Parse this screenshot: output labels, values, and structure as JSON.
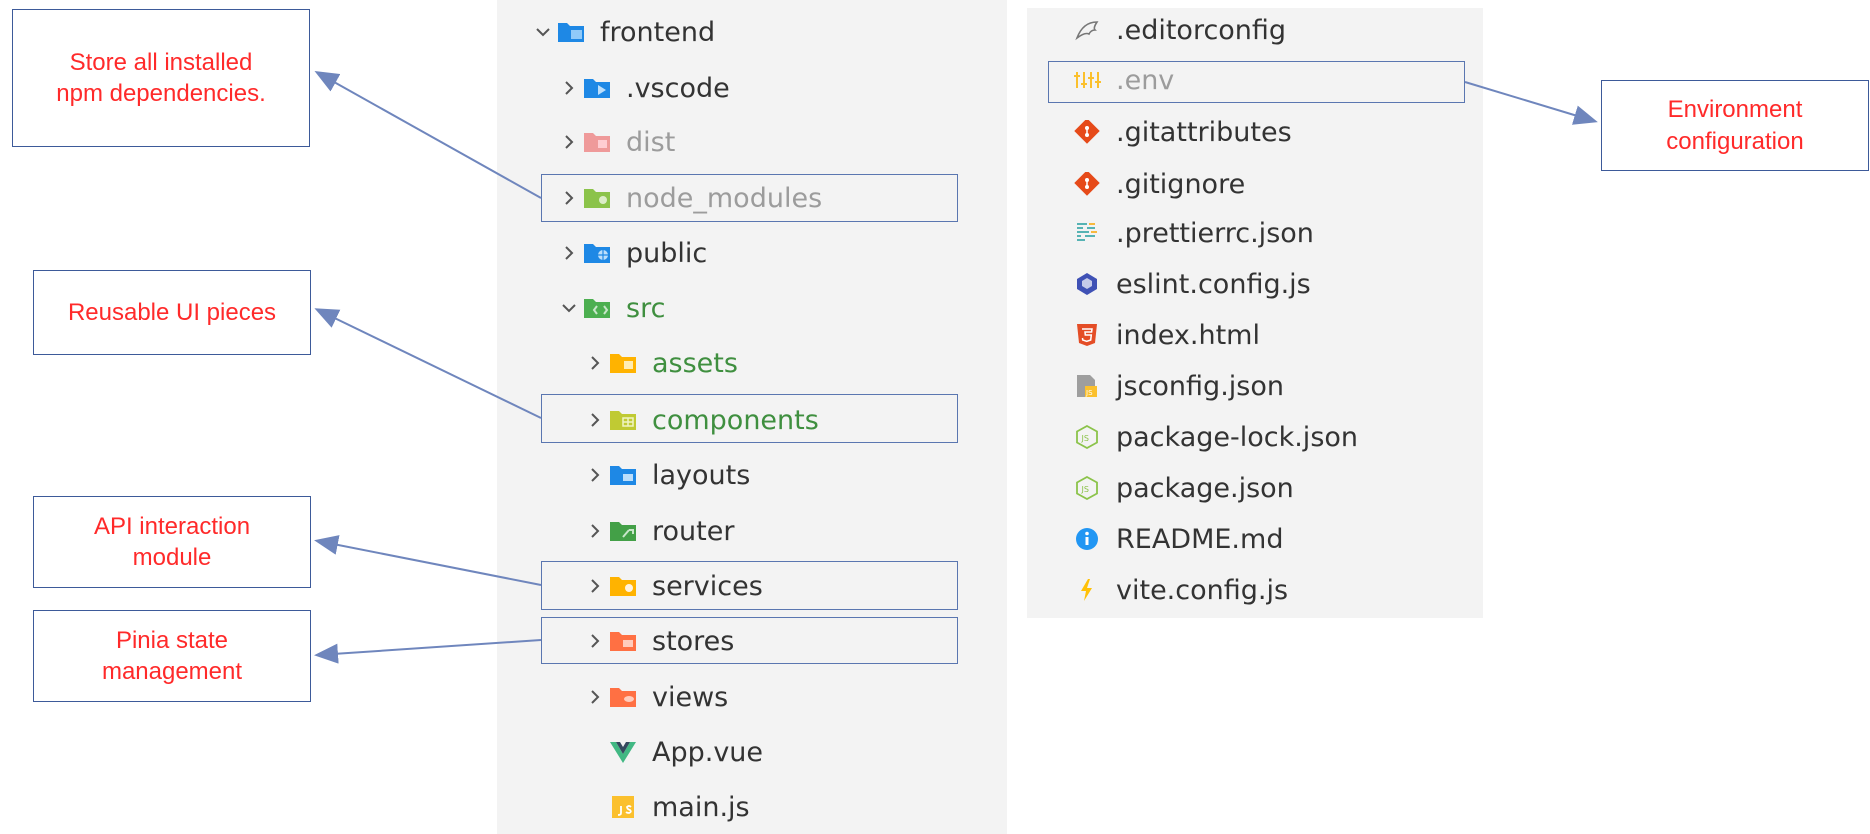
{
  "left_tree": [
    {
      "label": "frontend",
      "icon": "folder-frontend-icon",
      "chevron": "down"
    },
    {
      "label": ".vscode",
      "icon": "folder-vscode-icon",
      "chevron": "right"
    },
    {
      "label": "dist",
      "icon": "folder-dist-icon",
      "chevron": "right",
      "dim": true
    },
    {
      "label": "node_modules",
      "icon": "folder-node-icon",
      "chevron": "right",
      "dim": true
    },
    {
      "label": "public",
      "icon": "folder-public-icon",
      "chevron": "right"
    },
    {
      "label": "src",
      "icon": "folder-src-icon",
      "chevron": "down",
      "green": true
    },
    {
      "label": "assets",
      "icon": "folder-assets-icon",
      "chevron": "right",
      "green": true
    },
    {
      "label": "components",
      "icon": "folder-components-icon",
      "chevron": "right",
      "green": true
    },
    {
      "label": "layouts",
      "icon": "folder-layouts-icon",
      "chevron": "right"
    },
    {
      "label": "router",
      "icon": "folder-router-icon",
      "chevron": "right"
    },
    {
      "label": "services",
      "icon": "folder-services-icon",
      "chevron": "right"
    },
    {
      "label": "stores",
      "icon": "folder-stores-icon",
      "chevron": "right"
    },
    {
      "label": "views",
      "icon": "folder-views-icon",
      "chevron": "right"
    },
    {
      "label": "App.vue",
      "icon": "vue-file-icon",
      "chevron": "none"
    },
    {
      "label": "main.js",
      "icon": "js-file-icon",
      "chevron": "none"
    }
  ],
  "right_files": [
    {
      "label": ".editorconfig",
      "icon": "editorconfig-icon"
    },
    {
      "label": ".env",
      "icon": "env-settings-icon",
      "dim": true
    },
    {
      "label": ".gitattributes",
      "icon": "git-icon"
    },
    {
      "label": ".gitignore",
      "icon": "git-icon"
    },
    {
      "label": ".prettierrc.json",
      "icon": "prettier-icon"
    },
    {
      "label": "eslint.config.js",
      "icon": "eslint-icon"
    },
    {
      "label": "index.html",
      "icon": "html5-icon"
    },
    {
      "label": "jsconfig.json",
      "icon": "jsconfig-icon"
    },
    {
      "label": "package-lock.json",
      "icon": "nodejs-icon"
    },
    {
      "label": "package.json",
      "icon": "nodejs-icon"
    },
    {
      "label": "README.md",
      "icon": "info-icon"
    },
    {
      "label": "vite.config.js",
      "icon": "vite-icon"
    }
  ],
  "callouts": {
    "node_modules": "Store all installed\nnpm dependencies.",
    "components": "Reusable UI pieces",
    "services": "API interaction\nmodule",
    "stores": "Pinia state\nmanagement",
    "env": "Environment\nconfiguration"
  },
  "colors": {
    "callout_text": "#ff2a2a",
    "callout_border": "#3d5a99",
    "arrow": "#6f86bd",
    "panel_bg": "#f3f3f3"
  }
}
